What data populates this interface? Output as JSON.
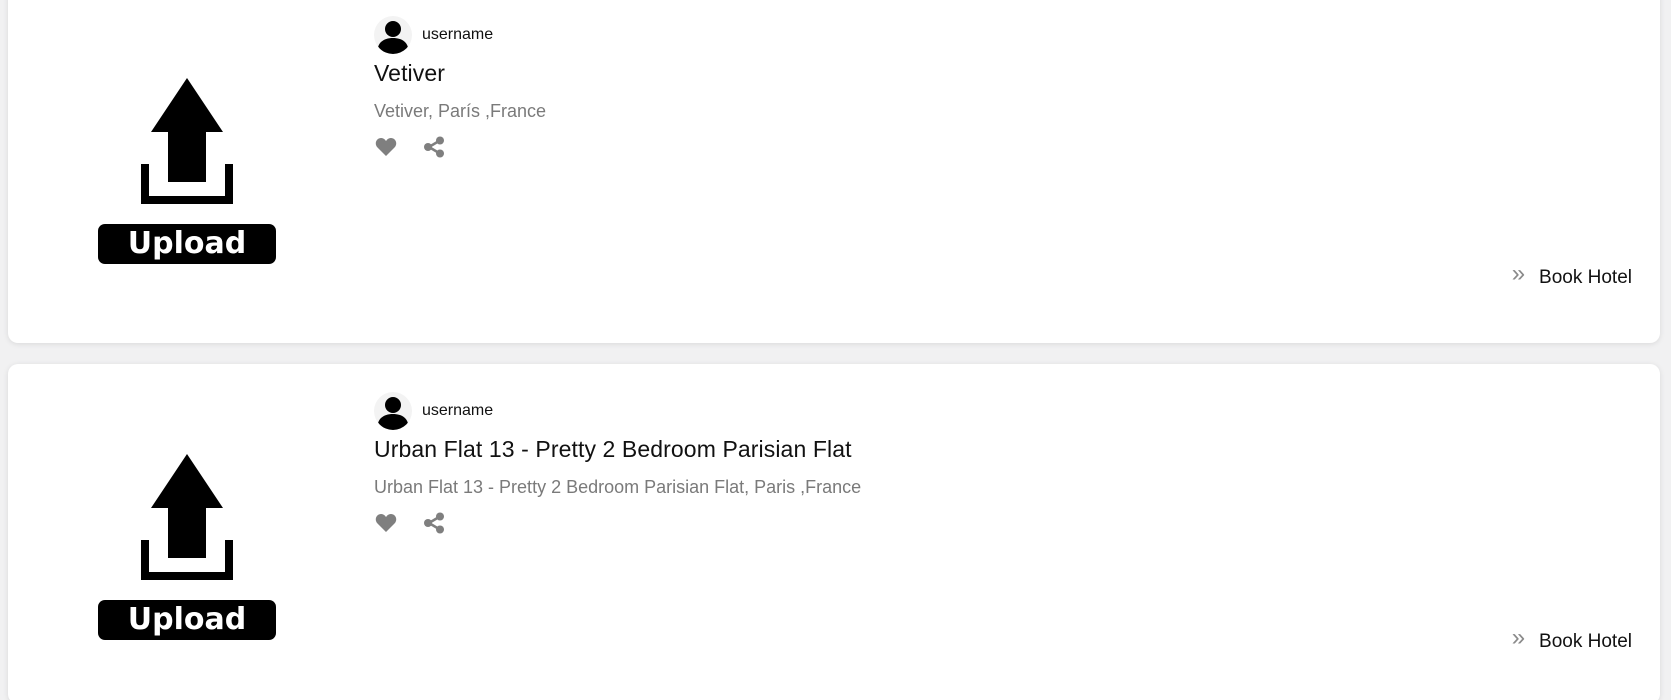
{
  "listings": [
    {
      "username": "username",
      "title": "Vetiver",
      "location": "Vetiver, París ,France",
      "thumbnail_label": "Upload",
      "book_label": "Book Hotel",
      "book_icon": "double-chevron-right-icon"
    },
    {
      "username": "username",
      "title": "Urban Flat 13 - Pretty 2 Bedroom Parisian Flat",
      "location": "Urban Flat 13 - Pretty 2 Bedroom Parisian Flat, Paris ,France",
      "thumbnail_label": "Upload",
      "book_label": "Book Hotel",
      "book_icon": "double-chevron-right-icon"
    }
  ],
  "icons": {
    "like": "heart-icon",
    "share": "share-icon",
    "avatar": "user-avatar-icon"
  },
  "colors": {
    "page_background": "#f1f1f2",
    "card_background": "#ffffff",
    "title_text": "#111111",
    "location_text": "#7a7a7a",
    "icon_gray": "#7f7f7f"
  }
}
